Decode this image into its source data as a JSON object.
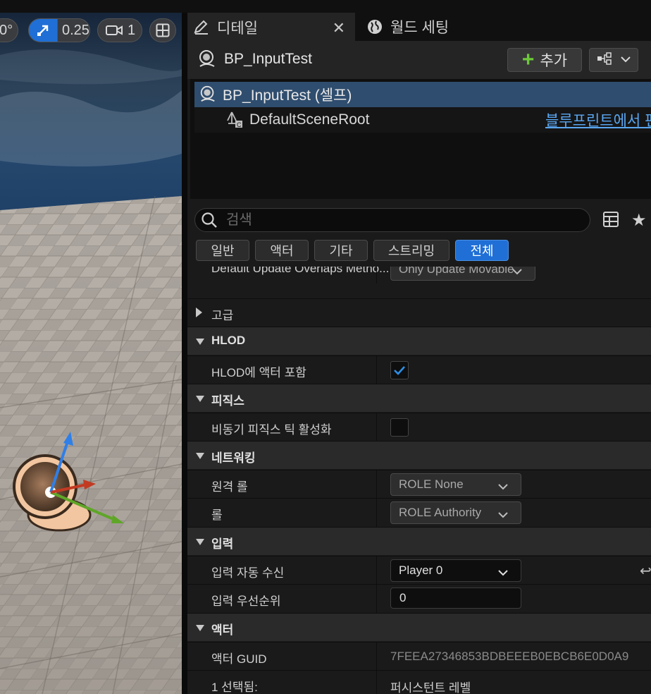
{
  "viewport": {
    "rotation_snap_value": "0°",
    "scale_snap_value": "0.25",
    "camera_speed_value": "1",
    "icons": [
      "scale-snap-icon",
      "camera-icon",
      "layout-grid-icon"
    ]
  },
  "tabs": [
    {
      "label": "디테일",
      "icon": "pencil-icon",
      "active": true,
      "closable": true
    },
    {
      "label": "월드 세팅",
      "icon": "globe-icon",
      "active": false
    }
  ],
  "header": {
    "title": "BP_InputTest",
    "add_label": "추가",
    "add_icon": "plus-icon",
    "hierarchy_icon": "hierarchy-icon"
  },
  "components": {
    "root_label": "BP_InputTest (셀프)",
    "child_label": "DefaultSceneRoot",
    "edit_link": "블루프린트에서 편"
  },
  "search": {
    "placeholder": "검색"
  },
  "filters": [
    "일반",
    "액터",
    "기타",
    "스트리밍",
    "전체"
  ],
  "active_filter": "전체",
  "properties": {
    "partial_row": {
      "label": "Default Update Overlaps Metho...",
      "value": "Only Update Movable"
    },
    "advanced_label": "고급",
    "hlod": {
      "category": "HLOD",
      "include_label": "HLOD에 액터 포함",
      "include_checked": true
    },
    "physics": {
      "category": "피직스",
      "async_label": "비동기 피직스 틱 활성화",
      "async_checked": false
    },
    "networking": {
      "category": "네트워킹",
      "remote_role_label": "원격 롤",
      "remote_role_value": "ROLE None",
      "role_label": "롤",
      "role_value": "ROLE Authority"
    },
    "input": {
      "category": "입력",
      "auto_receive_label": "입력 자동 수신",
      "auto_receive_value": "Player 0",
      "priority_label": "입력 우선순위",
      "priority_value": "0"
    },
    "actor": {
      "category": "액터",
      "guid_label": "액터 GUID",
      "guid_value": "7FEEA27346853BDBEEEB0EBCB6E0D0A9",
      "selected_label": "1 선택됨:",
      "selected_value": "퍼시스턴트 레벨"
    }
  },
  "colors": {
    "accent": "#1f6fd6",
    "link": "#5aa7f2",
    "check": "#2d8fe6"
  }
}
